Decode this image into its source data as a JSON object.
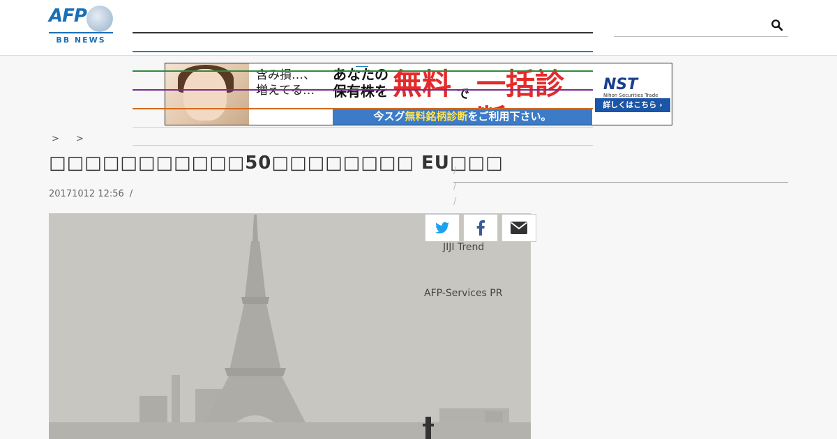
{
  "header": {
    "logo_text": "AFP",
    "logo_subtext": "BB NEWS"
  },
  "ad": {
    "copy_line1": "含み損…、",
    "copy_line2": "増えてる…",
    "headline_part1": "あなたの",
    "headline_part2": "保有株を",
    "headline_free": "無料",
    "headline_de": "で",
    "headline_diag": "一括診断!!",
    "bar_pre": "今スグ",
    "bar_hl": "無料銘柄診断",
    "bar_post": "をご利用下さい。",
    "brand": "NST",
    "brand_sub": "Nihon Securities Trade",
    "cta": "詳しくはこちら ›"
  },
  "breadcrumb": {
    "sep1": ">",
    "sep2": ">"
  },
  "article": {
    "title": "□□□□□□□□□□□50□□□□□□□□ EU□□□",
    "date": "20171012 12:56",
    "date_sep": "/"
  },
  "sidebar": {
    "links": [
      {
        "label": "JIJI Trend"
      },
      {
        "label": "AFP-Services PR"
      }
    ],
    "slash": "/"
  },
  "share": {
    "twitter": "twitter-icon",
    "facebook": "facebook-icon",
    "email": "envelope-icon"
  },
  "colors": {
    "brand_blue": "#1a6fb6",
    "nav_green": "#2e8b3a",
    "nav_purple": "#7b2b8e",
    "nav_orange": "#d46a1e",
    "twitter_blue": "#1da1f2",
    "facebook_blue": "#3b5998"
  }
}
